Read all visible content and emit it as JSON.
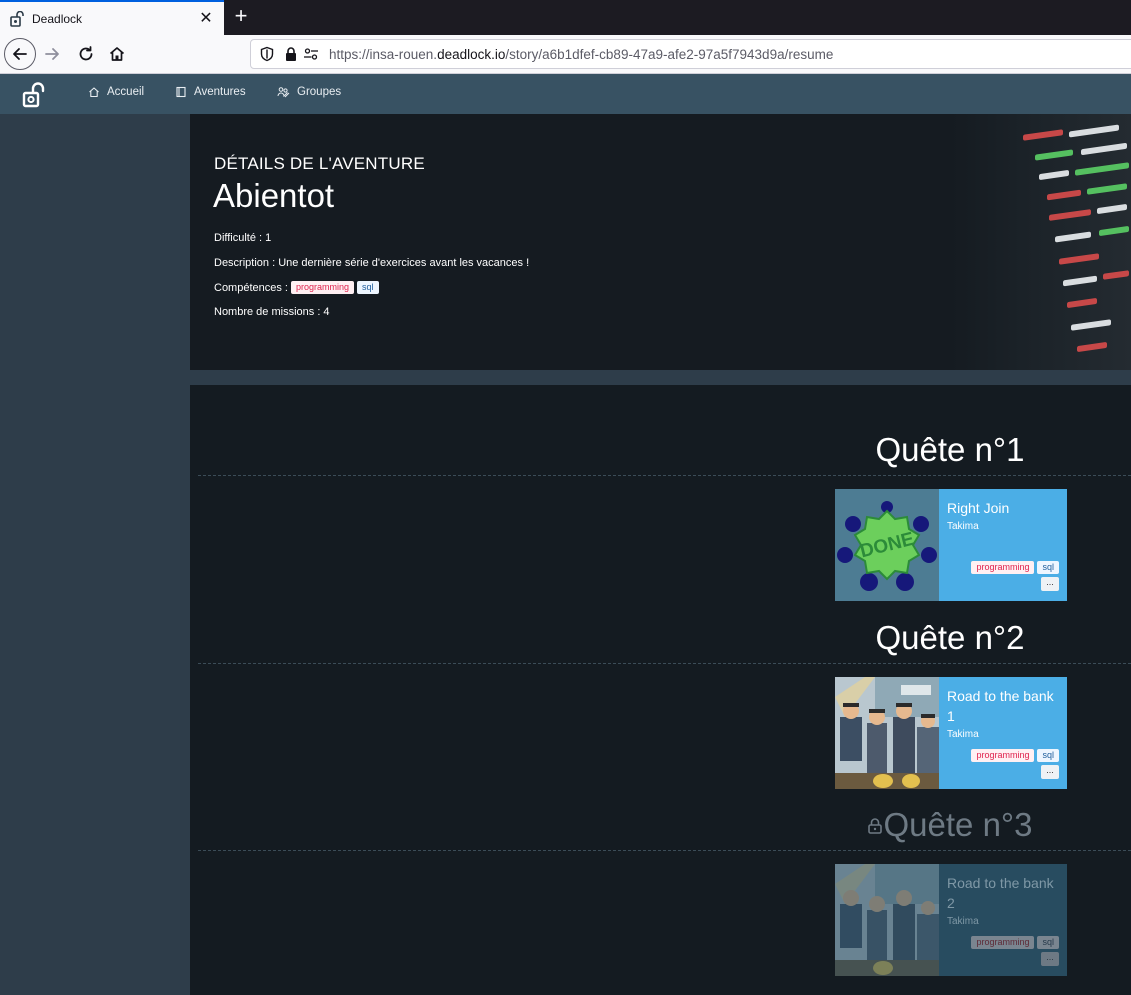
{
  "browser": {
    "tab_title": "Deadlock",
    "url_prefix": "https://insa-rouen.",
    "url_domain": "deadlock.io",
    "url_path": "/story/a6b1dfef-cb89-47a9-afe2-97a5f7943d9a/resume"
  },
  "nav": {
    "items": [
      {
        "label": "Accueil",
        "icon": "home-icon"
      },
      {
        "label": "Aventures",
        "icon": "book-icon"
      },
      {
        "label": "Groupes",
        "icon": "group-icon"
      }
    ]
  },
  "adventure": {
    "kicker": "DÉTAILS DE L'AVENTURE",
    "name": "Abientot",
    "difficulty_line": "Difficulté : 1",
    "description_line": "Description : Une dernière série d'exercices avant les vacances !",
    "skills_label": "Compétences :",
    "skills": [
      "programming",
      "sql"
    ],
    "missions_line": "Nombre de missions : 4"
  },
  "quests": [
    {
      "title": "Quête n°1",
      "locked": false,
      "card": {
        "title": "Right Join",
        "author": "Takima",
        "tags": [
          "programming",
          "sql"
        ],
        "more": "..."
      }
    },
    {
      "title": "Quête n°2",
      "locked": false,
      "card": {
        "title": "Road to the bank 1",
        "author": "Takima",
        "tags": [
          "programming",
          "sql"
        ],
        "more": "..."
      }
    },
    {
      "title": "Quête n°3",
      "locked": true,
      "card": {
        "title": "Road to the bank 2",
        "author": "Takima",
        "tags": [
          "programming",
          "sql"
        ],
        "more": "..."
      }
    }
  ],
  "colors": {
    "header": "#385263",
    "card": "#4baee6",
    "card_locked": "#284c60",
    "tag_programming": "#e0234e"
  }
}
